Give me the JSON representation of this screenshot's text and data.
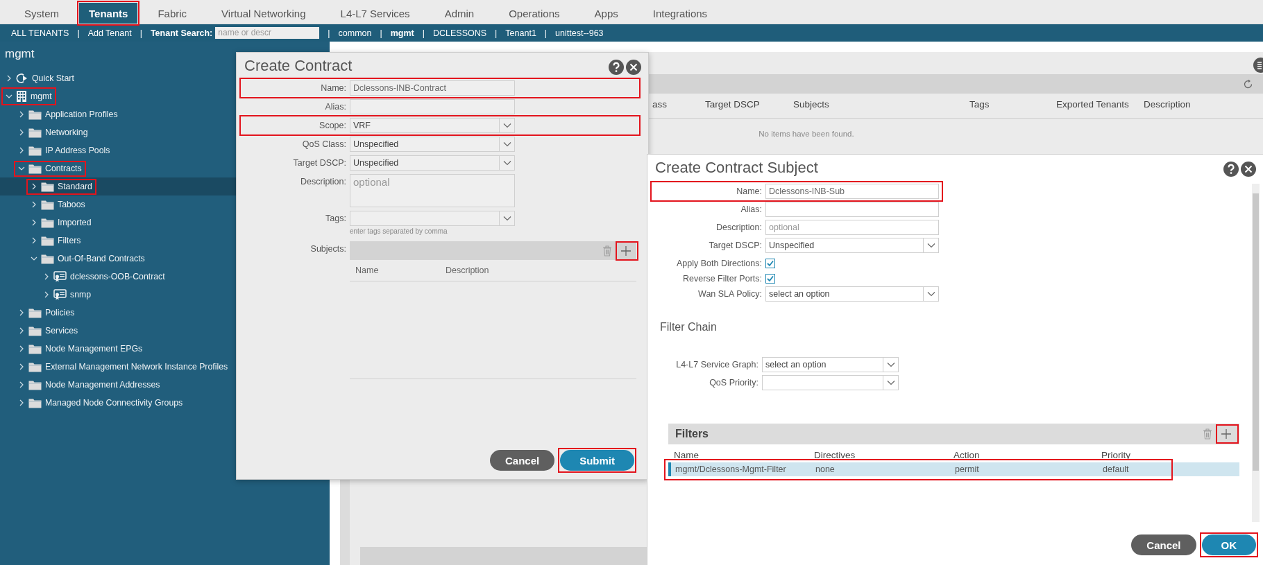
{
  "top_tabs": [
    {
      "label": "System",
      "selected": false,
      "highlighted": false
    },
    {
      "label": "Tenants",
      "selected": true,
      "highlighted": true
    },
    {
      "label": "Fabric",
      "selected": false,
      "highlighted": false
    },
    {
      "label": "Virtual Networking",
      "selected": false,
      "highlighted": false
    },
    {
      "label": "L4-L7 Services",
      "selected": false,
      "highlighted": false
    },
    {
      "label": "Admin",
      "selected": false,
      "highlighted": false
    },
    {
      "label": "Operations",
      "selected": false,
      "highlighted": false
    },
    {
      "label": "Apps",
      "selected": false,
      "highlighted": false
    },
    {
      "label": "Integrations",
      "selected": false,
      "highlighted": false
    }
  ],
  "tenant_bar": [
    {
      "kind": "link",
      "label": "ALL TENANTS",
      "current": false
    },
    {
      "kind": "separator",
      "label": "|"
    },
    {
      "kind": "link",
      "label": "Add Tenant",
      "current": false
    },
    {
      "kind": "separator",
      "label": "|"
    },
    {
      "kind": "search",
      "label": "Tenant Search:",
      "placeholder": "name or descr"
    },
    {
      "kind": "separator",
      "label": "|"
    },
    {
      "kind": "link",
      "label": "common",
      "current": false
    },
    {
      "kind": "separator",
      "label": "|"
    },
    {
      "kind": "link",
      "label": "mgmt",
      "current": true
    },
    {
      "kind": "separator",
      "label": "|"
    },
    {
      "kind": "link",
      "label": "DCLESSONS",
      "current": false
    },
    {
      "kind": "separator",
      "label": "|"
    },
    {
      "kind": "link",
      "label": "Tenant1",
      "current": false
    },
    {
      "kind": "separator",
      "label": "|"
    },
    {
      "kind": "link",
      "label": "unittest--963",
      "current": false
    }
  ],
  "sidebar": {
    "title": "mgmt",
    "tree": [
      {
        "label": "Quick Start",
        "kind": "quickstart",
        "expanded": false,
        "selected": false,
        "highlighted": false
      },
      {
        "label": "mgmt",
        "kind": "tenant",
        "expanded": true,
        "selected": false,
        "highlighted": true,
        "children": [
          {
            "label": "Application Profiles",
            "kind": "folder",
            "expanded": false,
            "selected": false,
            "highlighted": false
          },
          {
            "label": "Networking",
            "kind": "folder",
            "expanded": false,
            "selected": false,
            "highlighted": false
          },
          {
            "label": "IP Address Pools",
            "kind": "folder",
            "expanded": false,
            "selected": false,
            "highlighted": false
          },
          {
            "label": "Contracts",
            "kind": "folder",
            "expanded": true,
            "selected": false,
            "highlighted": true,
            "children": [
              {
                "label": "Standard",
                "kind": "folder",
                "expanded": false,
                "selected": true,
                "highlighted": true
              },
              {
                "label": "Taboos",
                "kind": "folder",
                "expanded": false,
                "selected": false,
                "highlighted": false
              },
              {
                "label": "Imported",
                "kind": "folder",
                "expanded": false,
                "selected": false,
                "highlighted": false
              },
              {
                "label": "Filters",
                "kind": "folder",
                "expanded": false,
                "selected": false,
                "highlighted": false
              },
              {
                "label": "Out-Of-Band Contracts",
                "kind": "folder",
                "expanded": true,
                "selected": false,
                "highlighted": false,
                "children": [
                  {
                    "label": "dclessons-OOB-Contract",
                    "kind": "contract",
                    "expanded": false,
                    "selected": false,
                    "highlighted": false
                  },
                  {
                    "label": "snmp",
                    "kind": "contract",
                    "expanded": false,
                    "selected": false,
                    "highlighted": false
                  }
                ]
              }
            ]
          },
          {
            "label": "Policies",
            "kind": "folder",
            "expanded": false,
            "selected": false,
            "highlighted": false
          },
          {
            "label": "Services",
            "kind": "folder",
            "expanded": false,
            "selected": false,
            "highlighted": false
          },
          {
            "label": "Node Management EPGs",
            "kind": "folder",
            "expanded": false,
            "selected": false,
            "highlighted": false
          },
          {
            "label": "External Management Network Instance Profiles",
            "kind": "folder",
            "expanded": false,
            "selected": false,
            "highlighted": false
          },
          {
            "label": "Node Management Addresses",
            "kind": "folder",
            "expanded": false,
            "selected": false,
            "highlighted": false
          },
          {
            "label": "Managed Node Connectivity Groups",
            "kind": "folder",
            "expanded": false,
            "selected": false,
            "highlighted": false
          }
        ]
      }
    ]
  },
  "contracts_table": {
    "columns": [
      "ass",
      "Target DSCP",
      "Subjects",
      "Tags",
      "Exported Tenants",
      "Description"
    ],
    "empty_message": "No items have been found."
  },
  "create_contract": {
    "title": "Create Contract",
    "fields": [
      {
        "kind": "text",
        "label": "Name:",
        "value": "Dclessons-INB-Contract",
        "highlighted": true
      },
      {
        "kind": "text",
        "label": "Alias:",
        "highlighted": false
      },
      {
        "kind": "select",
        "label": "Scope:",
        "value": "VRF",
        "highlighted": true
      },
      {
        "kind": "select",
        "label": "QoS Class:",
        "value": "Unspecified",
        "highlighted": false
      },
      {
        "kind": "select",
        "label": "Target DSCP:",
        "value": "Unspecified",
        "highlighted": false
      },
      {
        "kind": "textarea",
        "label": "Description:",
        "placeholder": "optional",
        "highlighted": false
      },
      {
        "kind": "select",
        "label": "Tags:",
        "hint": "enter tags separated by comma",
        "highlighted": false
      }
    ],
    "subjects": {
      "label": "Subjects:",
      "columns": [
        "Name",
        "Description"
      ],
      "add_highlighted": true
    },
    "buttons": [
      {
        "kind": "secondary",
        "label": "Cancel",
        "highlighted": false
      },
      {
        "kind": "primary",
        "label": "Submit",
        "highlighted": true
      }
    ]
  },
  "create_subject": {
    "title": "Create Contract Subject",
    "fields": [
      {
        "kind": "text",
        "label": "Name:",
        "value": "Dclessons-INB-Sub",
        "highlighted": true
      },
      {
        "kind": "text",
        "label": "Alias:",
        "highlighted": false
      },
      {
        "kind": "text",
        "label": "Description:",
        "placeholder": "optional",
        "highlighted": false
      },
      {
        "kind": "select",
        "label": "Target DSCP:",
        "value": "Unspecified",
        "highlighted": false
      },
      {
        "kind": "checkbox",
        "label": "Apply Both Directions:",
        "checked": true,
        "highlighted": false
      },
      {
        "kind": "checkbox",
        "label": "Reverse Filter Ports:",
        "checked": true,
        "highlighted": false
      },
      {
        "kind": "select",
        "label": "Wan SLA Policy:",
        "value": "select an option",
        "highlighted": false
      }
    ],
    "filter_chain": {
      "title": "Filter Chain",
      "fields": [
        {
          "kind": "select",
          "label": "L4-L7 Service Graph:",
          "value": "select an option",
          "highlighted": false
        },
        {
          "kind": "select",
          "label": "QoS Priority:",
          "highlighted": false
        }
      ]
    },
    "filters": {
      "title": "Filters",
      "add_highlighted": true,
      "columns": [
        "Name",
        "Directives",
        "Action",
        "Priority"
      ],
      "rows": [
        {
          "cells": [
            "mgmt/Dclessons-Mgmt-Filter",
            "none",
            "permit",
            "default"
          ],
          "selected": true,
          "highlighted": true
        }
      ]
    },
    "buttons": [
      {
        "kind": "secondary",
        "label": "Cancel",
        "highlighted": false
      },
      {
        "kind": "primary",
        "label": "OK",
        "highlighted": true
      }
    ]
  }
}
